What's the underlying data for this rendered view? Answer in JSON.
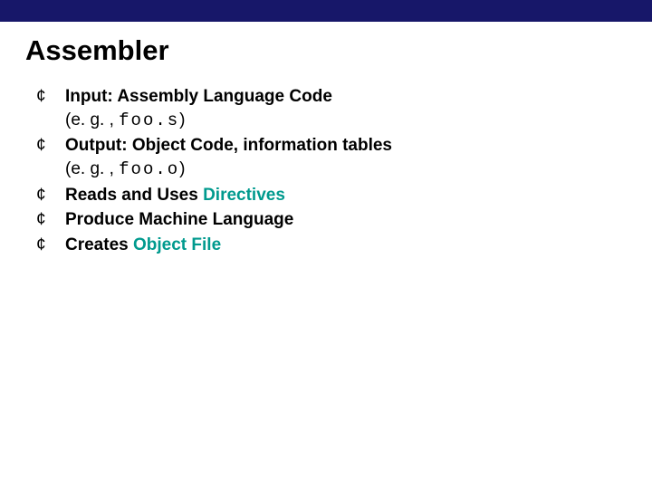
{
  "title": "Assembler",
  "items": [
    {
      "lead": "Input: Assembly Language Code",
      "eg_prefix": "(e. g. , ",
      "eg_code": "foo.s",
      "eg_suffix": ")"
    },
    {
      "lead": "Output: Object Code, information tables",
      "eg_prefix": "(e. g. , ",
      "eg_code": "foo.o",
      "eg_suffix": ")"
    },
    {
      "lead_a": "Reads and Uses ",
      "hl": "Directives"
    },
    {
      "lead": "Produce Machine Language"
    },
    {
      "lead_a": "Creates ",
      "hl": "Object File"
    }
  ]
}
